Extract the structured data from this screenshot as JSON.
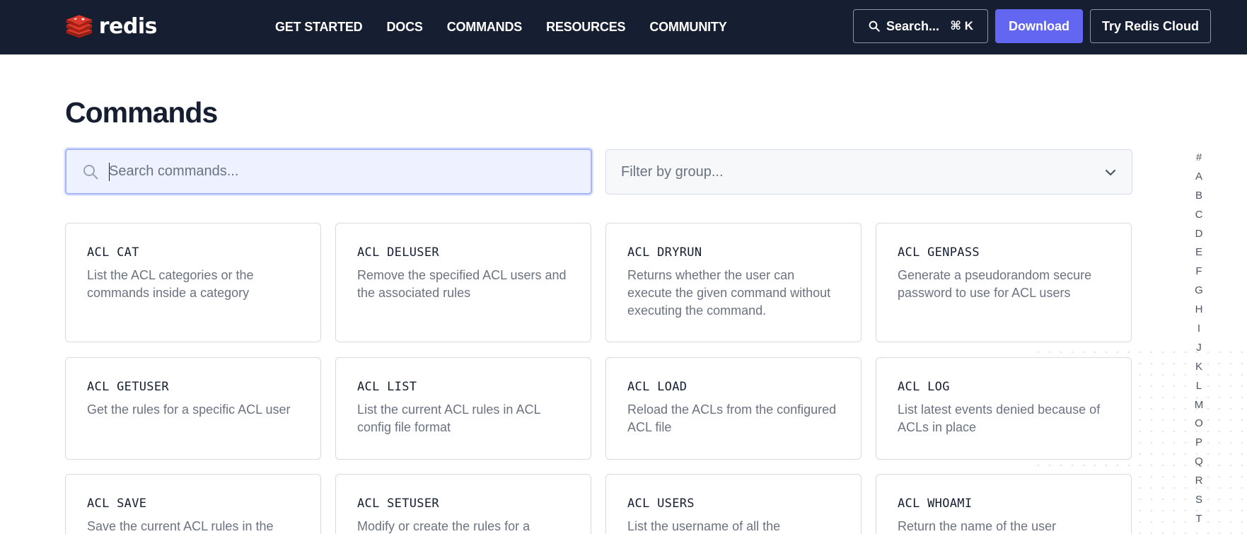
{
  "header": {
    "brand": "redis",
    "nav": [
      "GET STARTED",
      "DOCS",
      "COMMANDS",
      "RESOURCES",
      "COMMUNITY"
    ],
    "search_label": "Search...",
    "search_shortcut": "⌘ K",
    "download_label": "Download",
    "cloud_label": "Try Redis Cloud"
  },
  "main": {
    "title": "Commands",
    "search_placeholder": "Search commands...",
    "filter_placeholder": "Filter by group..."
  },
  "commands": [
    {
      "name": "ACL CAT",
      "desc": "List the ACL categories or the commands inside a category"
    },
    {
      "name": "ACL DELUSER",
      "desc": "Remove the specified ACL users and the associated rules"
    },
    {
      "name": "ACL DRYRUN",
      "desc": "Returns whether the user can execute the given command without executing the command."
    },
    {
      "name": "ACL GENPASS",
      "desc": "Generate a pseudorandom secure password to use for ACL users"
    },
    {
      "name": "ACL GETUSER",
      "desc": "Get the rules for a specific ACL user"
    },
    {
      "name": "ACL LIST",
      "desc": "List the current ACL rules in ACL config file format"
    },
    {
      "name": "ACL LOAD",
      "desc": "Reload the ACLs from the configured ACL file"
    },
    {
      "name": "ACL LOG",
      "desc": "List latest events denied because of ACLs in place"
    },
    {
      "name": "ACL SAVE",
      "desc": "Save the current ACL rules in the"
    },
    {
      "name": "ACL SETUSER",
      "desc": "Modify or create the rules for a"
    },
    {
      "name": "ACL USERS",
      "desc": "List the username of all the"
    },
    {
      "name": "ACL WHOAMI",
      "desc": "Return the name of the user"
    }
  ],
  "alphabet": [
    "#",
    "A",
    "B",
    "C",
    "D",
    "E",
    "F",
    "G",
    "H",
    "I",
    "J",
    "K",
    "L",
    "M",
    "O",
    "P",
    "Q",
    "R",
    "S",
    "T"
  ],
  "colors": {
    "header_bg": "#161f31",
    "accent": "#6366f1",
    "logo_red": "#dc382d"
  },
  "icons": {
    "logo": "redis-logo-icon",
    "search": "search-icon",
    "dropdown": "chevron-down-icon"
  }
}
